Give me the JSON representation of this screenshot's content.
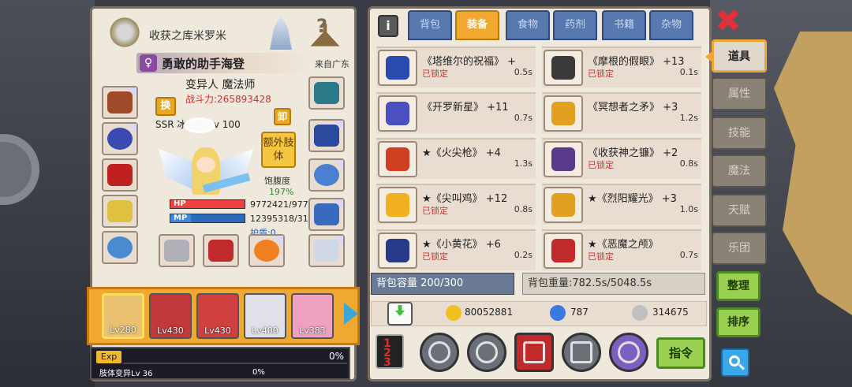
{
  "character": {
    "guild_name": "收获之库米罗米",
    "title": "勇敢的助手海登",
    "title_icon": "♀",
    "origin": "来自广东",
    "class_line": "变异人 魔法师",
    "power_label": "战斗力:265893428",
    "rank_line": "SSR 冰魔导 Lv 100",
    "swap_label": "换",
    "unload_label": "卸",
    "extra_body_label": "额外肢体",
    "hunger_label": "饱腹度",
    "hunger_value": "197%",
    "hp_label": "HP",
    "mp_label": "MP",
    "hp_value": "9772421/977",
    "mp_value": "12395318/31",
    "hp_fill": 1.0,
    "mp_fill": 0.28,
    "shield_label": "护盾:0"
  },
  "equipment_icons": [
    "hat-icon",
    "necklace-icon",
    "cape-icon",
    "amulet-icon",
    "ring-icon",
    "shield-emblem-icon",
    "armlet-icon",
    "bracelet-icon",
    "boots-icon",
    "robot-pet-icon",
    "scythe-blade-icon",
    "staff-icon",
    "pumpkin-icon"
  ],
  "team": [
    {
      "level": "Lv280",
      "selected": true,
      "color": "#e8c070"
    },
    {
      "level": "Lv430",
      "selected": false,
      "color": "#c03a3a"
    },
    {
      "level": "Lv430",
      "selected": false,
      "color": "#d04040"
    },
    {
      "level": "Lv400",
      "selected": false,
      "color": "#e0e0e8"
    },
    {
      "level": "Lv383",
      "selected": false,
      "color": "#f0a0c0"
    }
  ],
  "exp": {
    "label": "Exp",
    "percent": "0%",
    "sub_label": "肢体变异Lv 36",
    "sub_percent": "0%"
  },
  "inventory": {
    "info_label": "i",
    "tabs": [
      {
        "label": "背包",
        "active": false
      },
      {
        "label": "装备",
        "active": true
      },
      {
        "label": "食物",
        "active": false
      },
      {
        "label": "药剂",
        "active": false
      },
      {
        "label": "书籍",
        "active": false
      },
      {
        "label": "杂物",
        "active": false
      }
    ],
    "items": [
      {
        "name": "《塔维尔的祝福》 +",
        "locked": "已锁定",
        "weight": "0.5s",
        "color": "#2a4ab0",
        "icon": "bracelet-icon"
      },
      {
        "name": "《摩根的假眼》 +13",
        "locked": "已锁定",
        "weight": "0.1s",
        "color": "#3a3a3a",
        "icon": "eye-amulet-icon"
      },
      {
        "name": "《开罗新星》 +11",
        "locked": "",
        "weight": "0.7s",
        "color": "#4a50c0",
        "icon": "sword-icon"
      },
      {
        "name": "《冥想者之矛》 +3",
        "locked": "",
        "weight": "1.2s",
        "color": "#e0a020",
        "icon": "spear-icon"
      },
      {
        "name": "★《火尖枪》 +4",
        "locked": "",
        "weight": "1.3s",
        "color": "#d04020",
        "icon": "fire-spear-icon"
      },
      {
        "name": "《收获神之镰》 +2",
        "locked": "已锁定",
        "weight": "0.8s",
        "color": "#5a3a8a",
        "icon": "scythe-icon"
      },
      {
        "name": "★《尖叫鸡》 +12",
        "locked": "已锁定",
        "weight": "0.8s",
        "color": "#f0b020",
        "icon": "chicken-icon"
      },
      {
        "name": "★《烈阳耀光》 +3",
        "locked": "",
        "weight": "1.0s",
        "color": "#e0a020",
        "icon": "sun-axe-icon"
      },
      {
        "name": "★《小黄花》 +6",
        "locked": "已锁定",
        "weight": "0.2s",
        "color": "#2a3a8a",
        "icon": "flower-icon"
      },
      {
        "name": "★《恶魔之颅》",
        "locked": "已锁定",
        "weight": "0.7s",
        "color": "#c02a2a",
        "icon": "demon-skull-icon"
      }
    ],
    "capacity_label": "背包容量 200/300",
    "weight_label": "背包重量:782.5s/5048.5s",
    "currency": [
      {
        "value": "80052881",
        "icon": "gold-coin-icon",
        "color": "#f0c020"
      },
      {
        "value": "787",
        "icon": "diamond-icon",
        "color": "#3a7ae0"
      },
      {
        "value": "314675",
        "icon": "silver-coin-icon",
        "color": "#c0c0c0"
      }
    ],
    "command_label": "指令",
    "sort_digits": "1 2 3"
  },
  "side_nav": {
    "close_icon": "✖",
    "tabs": [
      {
        "label": "道具",
        "active": true
      },
      {
        "label": "属性",
        "active": false
      },
      {
        "label": "技能",
        "active": false
      },
      {
        "label": "魔法",
        "active": false
      },
      {
        "label": "天赋",
        "active": false
      },
      {
        "label": "乐团",
        "active": false
      }
    ],
    "organize_label": "整理",
    "sort_label": "排序"
  }
}
